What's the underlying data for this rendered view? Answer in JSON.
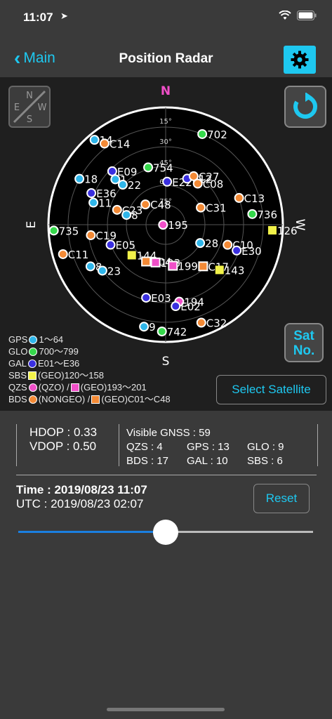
{
  "status": {
    "time": "11:07",
    "location_icon": "location-arrow-icon",
    "wifi_icon": "wifi-icon",
    "battery_icon": "battery-icon"
  },
  "nav": {
    "back_label": "Main",
    "title": "Position Radar",
    "settings_icon": "gear-icon"
  },
  "radar": {
    "directions": {
      "n": "N",
      "s": "S",
      "e": "E",
      "w": "W"
    },
    "elevations": [
      "15°",
      "30°",
      "45°",
      "60°",
      "75°"
    ],
    "compass_labels": {
      "n": "N",
      "s": "S",
      "e": "E",
      "w": "W"
    },
    "colors": {
      "gps": "#2fb6ea",
      "glo": "#35d84b",
      "gal": "#3a2fe0",
      "sbs": "#f2f24a",
      "qzs": "#f04fc8",
      "bds": "#f38a36"
    },
    "satellites": [
      {
        "label": "14",
        "sys": "gps",
        "az": 40,
        "el": 5
      },
      {
        "label": "C14",
        "sys": "bds",
        "az": 37,
        "el": 12
      },
      {
        "label": "702",
        "sys": "glo",
        "az": -22,
        "el": 15
      },
      {
        "label": "E09",
        "sys": "gal",
        "az": 45,
        "el": 32
      },
      {
        "label": "1",
        "sys": "gps",
        "az": 48,
        "el": 38
      },
      {
        "label": "18",
        "sys": "gps",
        "az": 62,
        "el": 15
      },
      {
        "label": "22",
        "sys": "gps",
        "az": 47,
        "el": 45
      },
      {
        "label": "E36",
        "sys": "gal",
        "az": 67,
        "el": 28
      },
      {
        "label": "11",
        "sys": "gps",
        "az": 73,
        "el": 32
      },
      {
        "label": "C48",
        "sys": "bds",
        "az": 45,
        "el": 68
      },
      {
        "label": "C23",
        "sys": "bds",
        "az": 73,
        "el": 51
      },
      {
        "label": "8",
        "sys": "gps",
        "az": 76,
        "el": 59
      },
      {
        "label": "754",
        "sys": "glo",
        "az": 17,
        "el": 44
      },
      {
        "label": "E22",
        "sys": "gal",
        "az": -2,
        "el": 57
      },
      {
        "label": "E12",
        "sys": "gal",
        "az": -25,
        "el": 51
      },
      {
        "label": "C27",
        "sys": "bds",
        "az": -30,
        "el": 47
      },
      {
        "label": "C08",
        "sys": "bds",
        "az": -38,
        "el": 50
      },
      {
        "label": "C31",
        "sys": "bds",
        "az": -64,
        "el": 60
      },
      {
        "label": "C13",
        "sys": "bds",
        "az": -70,
        "el": 30
      },
      {
        "label": "195",
        "sys": "qzs",
        "az": 92,
        "el": 88
      },
      {
        "label": "736",
        "sys": "glo",
        "az": -83,
        "el": 23
      },
      {
        "label": "735",
        "sys": "glo",
        "az": 93,
        "el": 4
      },
      {
        "label": "C19",
        "sys": "bds",
        "az": 98,
        "el": 32
      },
      {
        "label": "126",
        "sys": "sbs",
        "az": -93,
        "el": 8
      },
      {
        "label": "28",
        "sys": "gps",
        "az": -118,
        "el": 60
      },
      {
        "label": "C10",
        "sys": "bds",
        "az": -108,
        "el": 40
      },
      {
        "label": "E05",
        "sys": "gal",
        "az": 110,
        "el": 45
      },
      {
        "label": "C11",
        "sys": "bds",
        "az": 106,
        "el": 8
      },
      {
        "label": "E30",
        "sys": "gal",
        "az": -110,
        "el": 32
      },
      {
        "label": "8",
        "sys": "gps",
        "az": 119,
        "el": 24
      },
      {
        "label": "23",
        "sys": "gps",
        "az": 126,
        "el": 30
      },
      {
        "label": "144",
        "sys": "sbs",
        "az": 132,
        "el": 55
      },
      {
        "label": "C04",
        "sys": "bds",
        "az": 152,
        "el": 58
      },
      {
        "label": "193",
        "sys": "qzs",
        "az": 165,
        "el": 60
      },
      {
        "label": "199",
        "sys": "qzs",
        "az": -170,
        "el": 58
      },
      {
        "label": "C17",
        "sys": "bds",
        "az": -138,
        "el": 47
      },
      {
        "label": "143",
        "sys": "sbs",
        "az": -130,
        "el": 36
      },
      {
        "label": "E03",
        "sys": "gal",
        "az": 165,
        "el": 32
      },
      {
        "label": "194",
        "sys": "qzs",
        "az": -170,
        "el": 30
      },
      {
        "label": "E02",
        "sys": "gal",
        "az": -173,
        "el": 27
      },
      {
        "label": "9",
        "sys": "gps",
        "az": 168,
        "el": 10
      },
      {
        "label": "742",
        "sys": "glo",
        "az": 178,
        "el": 8
      },
      {
        "label": "C32",
        "sys": "bds",
        "az": -160,
        "el": 10
      }
    ]
  },
  "refresh_icon": "refresh-icon",
  "satno": {
    "line1": "Sat",
    "line2": "No."
  },
  "legend": {
    "gps": "GPS",
    "gps_range": "1～64",
    "glo": "GLO",
    "glo_range": "700～799",
    "gal": "GAL",
    "gal_range": "E01～E36",
    "sbs": "SBS",
    "sbs_range": "(GEO)120～158",
    "qzs": "QZS",
    "qzs_a": "(QZO) / ",
    "qzs_b": "(GEO)193～201",
    "bds": "BDS",
    "bds_a": "(NONGEO) / ",
    "bds_b": "(GEO)C01～C48"
  },
  "select_satellite": "Select Satellite",
  "dop": {
    "hdop": "HDOP : 0.33",
    "vdop": "VDOP : 0.50"
  },
  "gnss": {
    "visible": "Visible GNSS : 59",
    "qzs": "QZS : 4",
    "gps": "GPS : 13",
    "glo": "GLO : 9",
    "bds": "BDS : 17",
    "gal": "GAL : 10",
    "sbs": "SBS : 6"
  },
  "time": {
    "local": "Time : 2019/08/23 11:07",
    "utc": "UTC : 2019/08/23 02:07"
  },
  "reset": "Reset",
  "slider": {
    "value": 0.5
  }
}
